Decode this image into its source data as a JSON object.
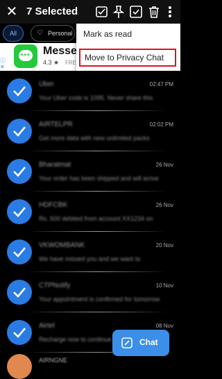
{
  "header": {
    "title": "7 Selected",
    "close_icon": "close-icon",
    "actions": [
      "mark-read-icon",
      "pin-icon",
      "bookmark-icon",
      "delete-icon",
      "more-vert-icon"
    ]
  },
  "filters": {
    "all": "All",
    "personal": "Personal"
  },
  "ad": {
    "name": "Messer",
    "rating": "4.3",
    "store": "FREE",
    "ad_mark": "ⓘ",
    "ad_close": "✕"
  },
  "menu": {
    "item1": "Mark as read",
    "item2": "Move to Privacy Chat"
  },
  "messages": [
    {
      "sender": "Uber",
      "preview": "Your Uber code is 1095. Never share this",
      "time": "02:47 PM"
    },
    {
      "sender": "AIRTELPR",
      "preview": "Get more data with new unlimited packs",
      "time": "02:02 PM"
    },
    {
      "sender": "Bharatmat",
      "preview": "Your order has been shipped and will arrive",
      "time": "26 Nov"
    },
    {
      "sender": "HDFCBK",
      "preview": "Rs. 500 debited from account XX1234 on",
      "time": "26 Nov"
    },
    {
      "sender": "VKWOMBANK",
      "preview": "We have missed you and we want to",
      "time": "20 Nov"
    },
    {
      "sender": "CTPNotify",
      "preview": "Your appointment is confirmed for tomorrow",
      "time": "10 Nov"
    },
    {
      "sender": "Airtel",
      "preview": "Recharge now to continue enjoying benefits",
      "time": "08 Nov"
    }
  ],
  "partial_row": {
    "sender": "AIRNGNE"
  },
  "fab": {
    "label": "Chat"
  },
  "colors": {
    "accent": "#2a7be4",
    "highlight": "#e01020",
    "fab": "#3b8fe8"
  }
}
